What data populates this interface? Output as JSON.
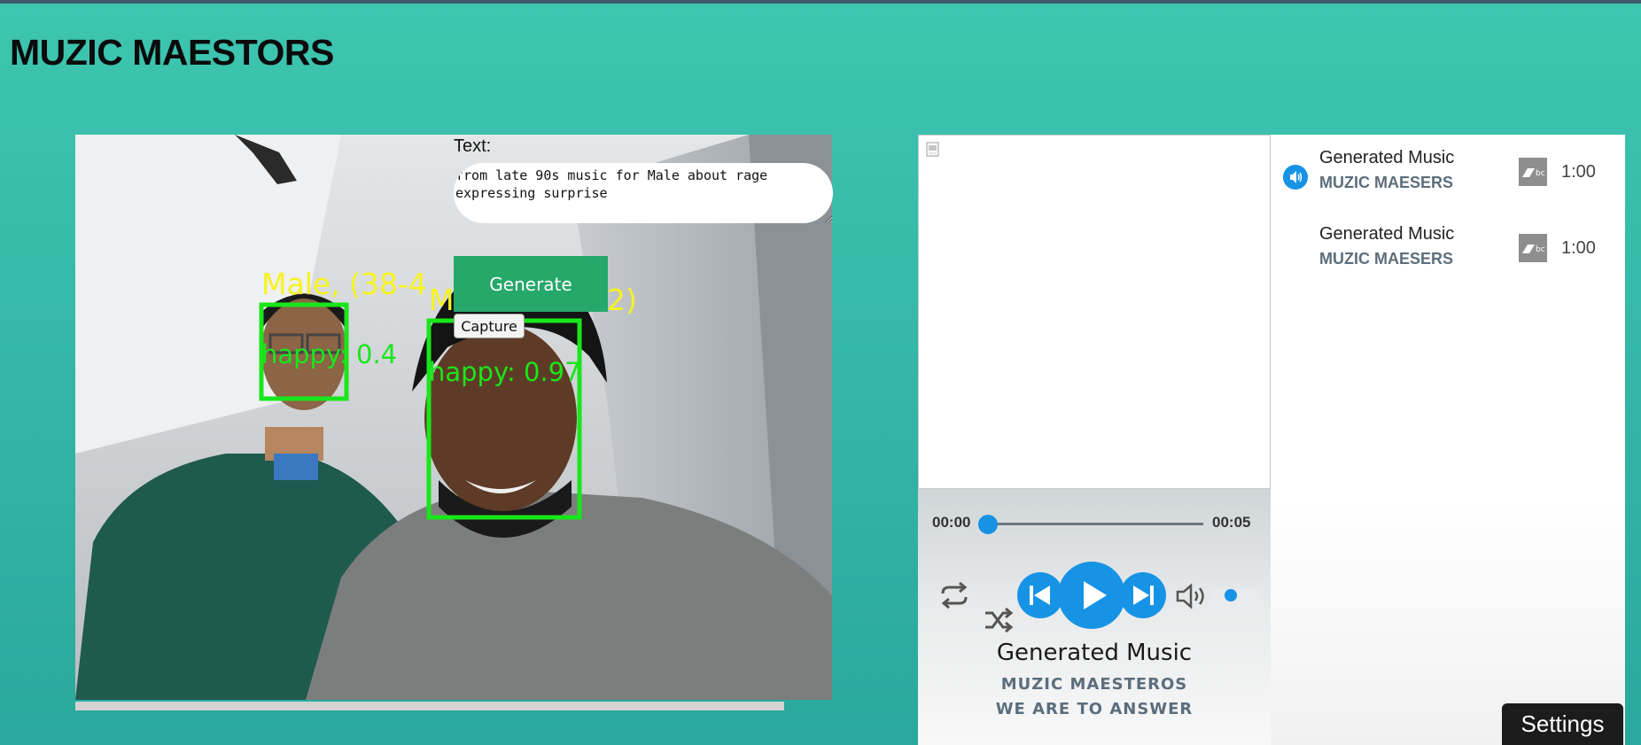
{
  "app": {
    "title": "MUZIC MAESTORS"
  },
  "camera": {
    "text_label": "Text:",
    "text_value": "from late 90s music for Male about rage\nexpressing surprise",
    "generate_label": "Generate",
    "capture_label": "Capture",
    "detections": [
      {
        "label": "Male, (38-4",
        "emotion": "happy: 0.4"
      },
      {
        "label": "M",
        "label_suffix": "2)",
        "emotion": "happy: 0.97"
      }
    ]
  },
  "player": {
    "current_time": "00:00",
    "total_time": "00:05",
    "progress": 0.0,
    "volume": 0.35,
    "now_playing": {
      "title": "Generated Music",
      "artist": "MUZIC MAESTEROS",
      "album": "WE ARE TO ANSWER"
    },
    "accent_color": "#1793e6"
  },
  "playlist": {
    "items": [
      {
        "title": "Generated Music",
        "artist": "MUZIC MAESERS",
        "duration": "1:00",
        "playing": true,
        "source_icon": "bandcamp-icon"
      },
      {
        "title": "Generated Music",
        "artist": "MUZIC MAESERS",
        "duration": "1:00",
        "playing": false,
        "source_icon": "bandcamp-icon"
      }
    ]
  },
  "settings": {
    "label": "Settings"
  }
}
